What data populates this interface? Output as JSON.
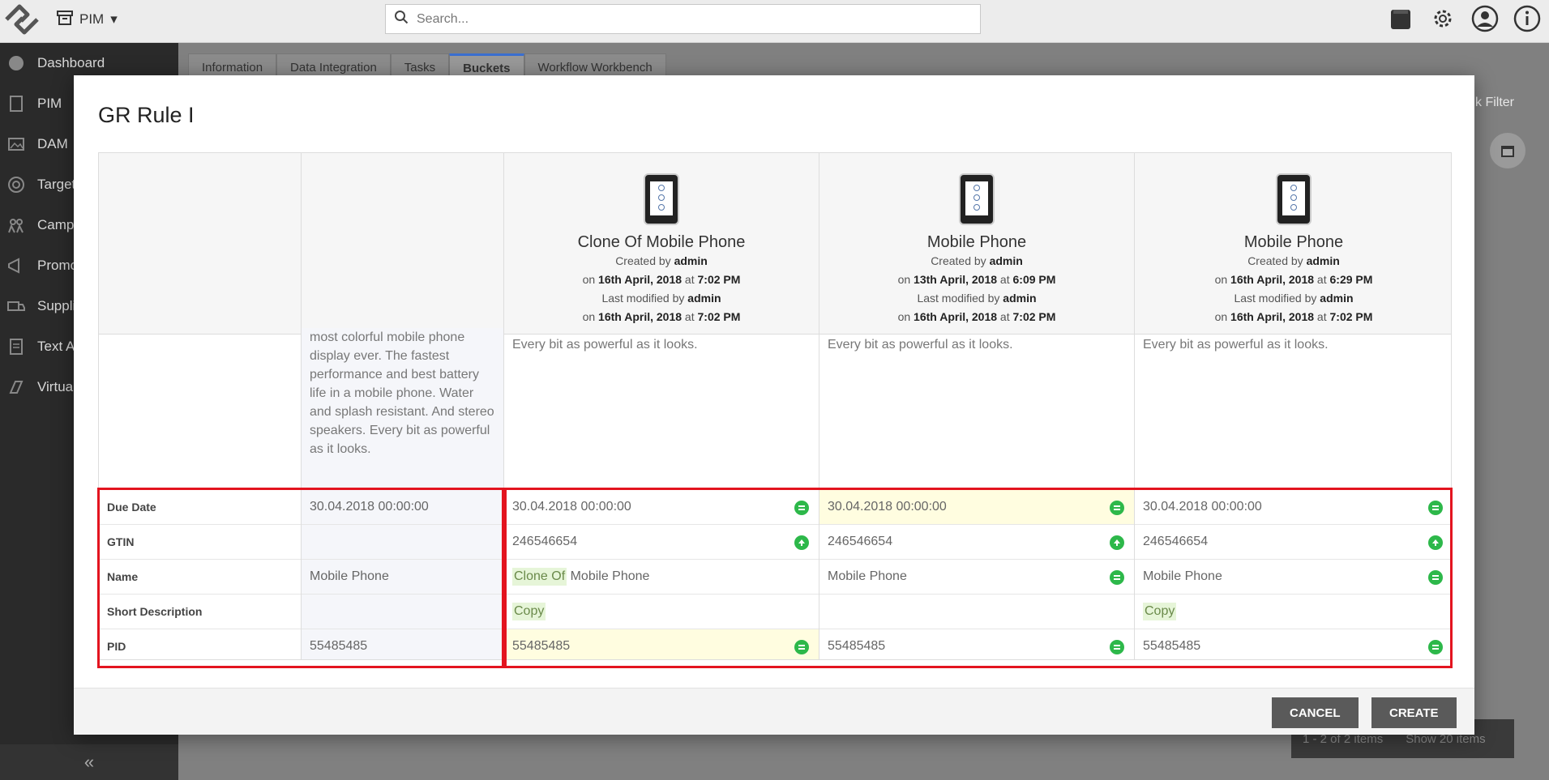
{
  "app": {
    "module_label": "PIM",
    "search_placeholder": "Search..."
  },
  "sidebar": {
    "items": [
      {
        "label": "Dashboard",
        "icon": "dashboard-icon"
      },
      {
        "label": "PIM",
        "icon": "pim-icon"
      },
      {
        "label": "DAM",
        "icon": "dam-icon"
      },
      {
        "label": "Target",
        "icon": "target-icon"
      },
      {
        "label": "Campa",
        "icon": "campaign-icon"
      },
      {
        "label": "Promo",
        "icon": "promo-icon"
      },
      {
        "label": "Suppli",
        "icon": "supplier-icon"
      },
      {
        "label": "Text A",
        "icon": "text-icon"
      },
      {
        "label": "Virtua",
        "icon": "virtual-icon"
      }
    ]
  },
  "tabs": [
    "Information",
    "Data Integration",
    "Tasks",
    "Buckets",
    "Workflow Workbench"
  ],
  "active_tab": "Buckets",
  "background": {
    "filter_label": "k Filter",
    "pager_count": "1 - 2 of 2 items",
    "pager_show": "Show 20 items"
  },
  "modal": {
    "title": "GR Rule I",
    "master_description": "most colorful mobile phone display ever. The fastest performance and best battery life in a mobile phone. Water and splash resistant. And stereo speakers. Every bit as powerful as it looks.",
    "field_labels": [
      "Due Date",
      "GTIN",
      "Name",
      "Short Description",
      "PID"
    ],
    "master_values": [
      "30.04.2018 00:00:00",
      "",
      "Mobile Phone",
      "",
      "55485485"
    ],
    "products": [
      {
        "title": "Clone Of Mobile Phone",
        "created_prefix": "Created by",
        "created_by": "admin",
        "created_on_prefix": "on",
        "created_date": "16th April, 2018",
        "created_at": "at",
        "created_time": "7:02 PM",
        "modified_prefix": "Last modified by",
        "modified_by": "admin",
        "modified_on_prefix": "on",
        "modified_date": "16th April, 2018",
        "modified_at": "at",
        "modified_time": "7:02 PM",
        "description": "Every bit as powerful as it looks.",
        "due_date": "30.04.2018 00:00:00",
        "gtin": "246546654",
        "name_prefix": "Clone Of",
        "name_rest": " Mobile Phone",
        "short_description": "Copy",
        "pid": "55485485"
      },
      {
        "title": "Mobile Phone",
        "created_prefix": "Created by",
        "created_by": "admin",
        "created_on_prefix": "on",
        "created_date": "13th April, 2018",
        "created_at": "at",
        "created_time": "6:09 PM",
        "modified_prefix": "Last modified by",
        "modified_by": "admin",
        "modified_on_prefix": "on",
        "modified_date": "16th April, 2018",
        "modified_at": "at",
        "modified_time": "7:02 PM",
        "description": "Every bit as powerful as it looks.",
        "due_date": "30.04.2018 00:00:00",
        "gtin": "246546654",
        "name": "Mobile Phone",
        "short_description": "",
        "pid": "55485485"
      },
      {
        "title": "Mobile Phone",
        "created_prefix": "Created by",
        "created_by": "admin",
        "created_on_prefix": "on",
        "created_date": "16th April, 2018",
        "created_at": "at",
        "created_time": "6:29 PM",
        "modified_prefix": "Last modified by",
        "modified_by": "admin",
        "modified_on_prefix": "on",
        "modified_date": "16th April, 2018",
        "modified_at": "at",
        "modified_time": "7:02 PM",
        "description": "Every bit as powerful as it looks.",
        "due_date": "30.04.2018 00:00:00",
        "gtin": "246546654",
        "name": "Mobile Phone",
        "short_description": "Copy",
        "pid": "55485485"
      }
    ],
    "cancel_label": "CANCEL",
    "create_label": "CREATE"
  },
  "colors": {
    "accent_red": "#e3141f",
    "status_green": "#2db84a",
    "highlight_yellow": "#fffde0",
    "chip_green": "#e6f5d8"
  }
}
